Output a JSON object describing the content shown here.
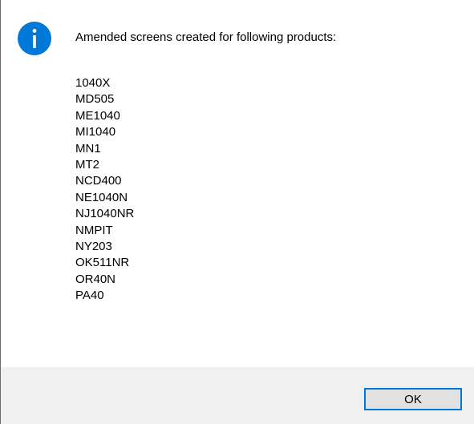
{
  "dialog": {
    "icon": "info-icon",
    "message": "Amended screens created for following products:",
    "products": [
      "1040X",
      "MD505",
      "ME1040",
      "MI1040",
      "MN1",
      "MT2",
      "NCD400",
      "NE1040N",
      "NJ1040NR",
      "NMPIT",
      "NY203",
      "OK511NR",
      "OR40N",
      "PA40"
    ],
    "ok_label": "OK"
  },
  "colors": {
    "icon_blue": "#0078d7",
    "footer_bg": "#f0f0f0",
    "button_bg": "#e1e1e1",
    "button_border": "#0078d7"
  }
}
